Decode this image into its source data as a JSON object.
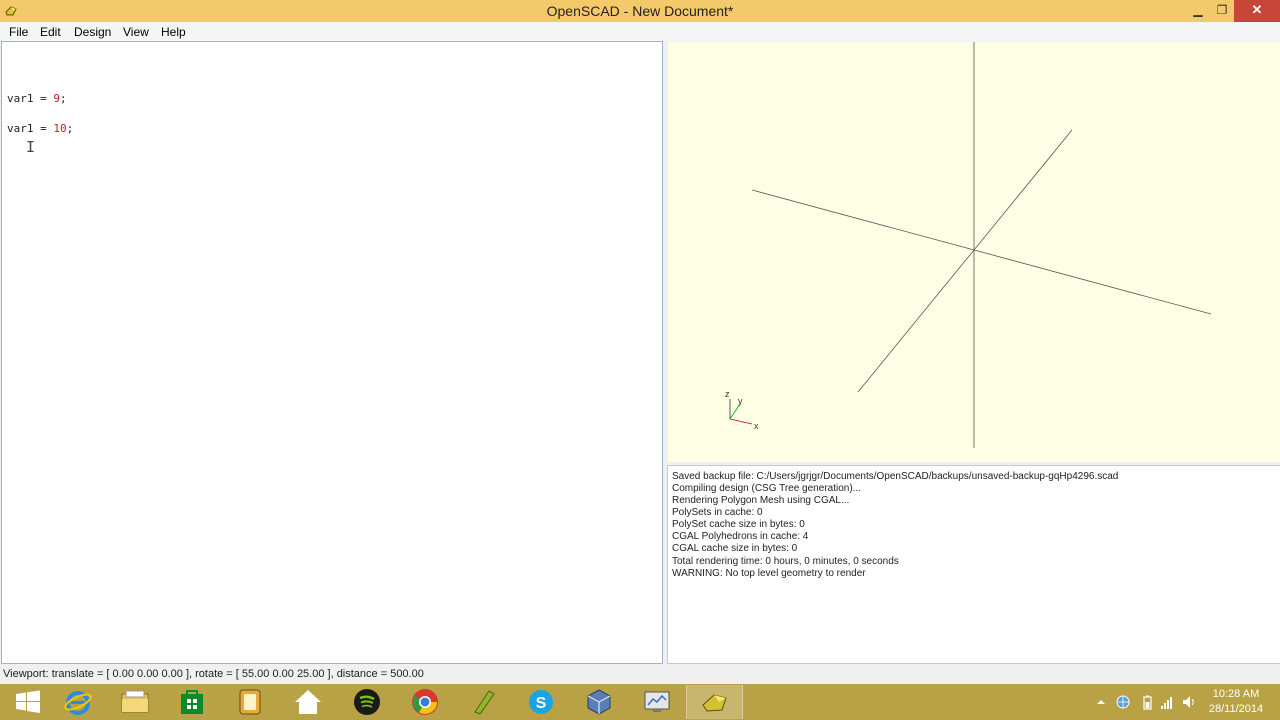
{
  "window": {
    "title": "OpenSCAD - New Document*"
  },
  "menu": [
    "File",
    "Edit",
    "Design",
    "View",
    "Help"
  ],
  "editor": {
    "lines": [
      {
        "name": "var1",
        "op": " = ",
        "value": "9",
        "end": ";"
      },
      {
        "name": "var1",
        "op": " = ",
        "value": "10",
        "end": ";"
      }
    ]
  },
  "viewport": {
    "axis_labels": {
      "z": "z",
      "y": "y",
      "x": "x"
    },
    "background": "#ffffe6"
  },
  "console": {
    "lines": [
      "Saved backup file: C:/Users/jgrjgr/Documents/OpenSCAD/backups/unsaved-backup-gqHp4296.scad",
      "Compiling design (CSG Tree generation)...",
      "Rendering Polygon Mesh using CGAL...",
      "PolySets in cache: 0",
      "PolySet cache size in bytes: 0",
      "CGAL Polyhedrons in cache: 4",
      "CGAL cache size in bytes: 0",
      "Total rendering time: 0 hours, 0 minutes, 0 seconds",
      "WARNING: No top level geometry to render"
    ]
  },
  "status": "Viewport: translate = [ 0.00 0.00 0.00 ], rotate = [ 55.00 0.00 25.00 ], distance = 500.00",
  "taskbar": {
    "apps": [
      "start",
      "internet-explorer",
      "file-explorer",
      "store",
      "notes",
      "home",
      "spotify",
      "chrome",
      "pen",
      "skype",
      "virtualbox",
      "system-info",
      "openscad"
    ],
    "clock_time": "10:28 AM",
    "clock_date": "28/11/2014"
  },
  "colors": {
    "titlebar": "#f4c96a",
    "taskbar": "#b9a146",
    "close": "#c7463a"
  }
}
